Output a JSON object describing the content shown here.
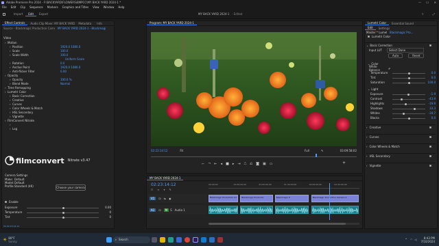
{
  "window": {
    "title": "Adobe Premiere Pro 2024 - F:\\BACKYARD\\FLOWERS\\BMPCC\\MY BACK YARD 2024-1 *",
    "menu": [
      "File",
      "Edit",
      "Clip",
      "Sequence",
      "Markers",
      "Graphics and Titles",
      "View",
      "Window",
      "Help"
    ]
  },
  "workspace": {
    "tabs": [
      "Import",
      "Edit",
      "Export"
    ],
    "active": "Edit",
    "project_title": "MY BACK YARD 2024-1",
    "project_status": "- Edited"
  },
  "effect_controls": {
    "tabs": [
      "Effect Controls",
      "Audio Clip Mixer: MY BACK YARD 2024-1",
      "Metadata",
      "Info"
    ],
    "source_label": "Source - Blackmagic Production Camera 4...",
    "sequence_label": "MY BACK YARD 2024-1 - Blackmagic P...",
    "mini_clip_label": "Blackmagic Production",
    "section_video": "Video",
    "properties": [
      {
        "name": "Motion",
        "value": "",
        "indent": 0
      },
      {
        "name": "Position",
        "value": "1920.0   1080.0",
        "indent": 1
      },
      {
        "name": "Scale",
        "value": "100.0",
        "indent": 1
      },
      {
        "name": "Scale Width",
        "value": "100.0",
        "indent": 1
      },
      {
        "name": "",
        "value": "Uniform Scale",
        "indent": 2
      },
      {
        "name": "Rotation",
        "value": "0.0",
        "indent": 1
      },
      {
        "name": "Anchor Point",
        "value": "1920.0   1080.0",
        "indent": 1
      },
      {
        "name": "Anti-flicker Filter",
        "value": "0.00",
        "indent": 1
      },
      {
        "name": "Opacity",
        "value": "",
        "indent": 0
      },
      {
        "name": "Opacity",
        "value": "100.0 %",
        "indent": 1
      },
      {
        "name": "Blend Mode",
        "value": "Normal",
        "indent": 1
      },
      {
        "name": "Time Remapping",
        "value": "",
        "indent": 0
      },
      {
        "name": "Lumetri Color",
        "value": "",
        "indent": 0
      },
      {
        "name": "Basic Correction",
        "value": "",
        "indent": 1
      },
      {
        "name": "Creative",
        "value": "",
        "indent": 1
      },
      {
        "name": "Curves",
        "value": "",
        "indent": 1
      },
      {
        "name": "Color Wheels & Match",
        "value": "",
        "indent": 1
      },
      {
        "name": "HSL Secondary",
        "value": "",
        "indent": 1
      },
      {
        "name": "Vignette",
        "value": "",
        "indent": 1
      },
      {
        "name": "FilmConvert Nitrate",
        "value": "",
        "indent": 0
      },
      {
        "name": "",
        "value": "",
        "indent": 1
      },
      {
        "name": "Log",
        "value": "",
        "indent": 1
      }
    ],
    "filmconvert": {
      "brand": "filmconvert",
      "product": "Nitrate v3.47",
      "camera_settings_label": "Camera Settings",
      "make_label": "Make:",
      "make": "Default",
      "model_label": "Model:",
      "model": "Default",
      "profile_label": "Profile:",
      "profile": "Standard (4K)",
      "choose_camera": "Choose your camera",
      "enable_label": "Enable",
      "sliders": [
        {
          "name": "Exposure",
          "value": "0.00",
          "fraction": 0.5
        },
        {
          "name": "Temperature",
          "value": "0",
          "fraction": 0.5
        },
        {
          "name": "Tint",
          "value": "0",
          "fraction": 0.5
        }
      ]
    }
  },
  "program_monitor": {
    "title": "Program: MY BACK YARD 2024-1",
    "timecode_current": "02:23:14:12",
    "fit": "Fit",
    "quality": "Full",
    "timecode_duration": "03:09:58:02"
  },
  "timeline": {
    "tab": "MY BACK YARD 2024-1",
    "timecode": "02:23:14:12",
    "ruler": [
      "00:00:00",
      "00:30:00:00",
      "01:00:00:00",
      "01:30:00:00",
      "02:00:00:00",
      "02:30:00:00"
    ],
    "tracks": [
      {
        "name": "V1",
        "type": "video"
      },
      {
        "name": "A1",
        "type": "audio",
        "label": "Audio 1"
      }
    ],
    "clips": [
      {
        "label": "Blackmagic Production Ca",
        "start": 0.0,
        "end": 0.2
      },
      {
        "label": "Blackmagic Productio",
        "start": 0.21,
        "end": 0.43
      },
      {
        "label": "Blackmagic P",
        "start": 0.44,
        "end": 0.67
      },
      {
        "label": "Blackmagic Production Camera 4",
        "start": 0.68,
        "end": 1.0
      }
    ],
    "playhead_fraction": 0.8
  },
  "lumetri": {
    "tabs": [
      "Lumetri Color",
      "Essential Sound"
    ],
    "sub_tabs": [
      "Edit",
      "Settings"
    ],
    "master_label": "Master * Lumetri Color",
    "source_label": "Blackmagic Pro...",
    "effect_label": "Lumetri Color",
    "basic_correction": "Basic Correction",
    "input_lut_label": "Input LUT",
    "input_lut_value": "Select Done",
    "auto_label": "Auto",
    "reset_label": "Reset",
    "color_label": "Color",
    "white_balance_label": "White Balance",
    "color_sliders": [
      {
        "name": "Temperature",
        "value": "0.0",
        "fraction": 0.5
      },
      {
        "name": "Tint",
        "value": "0.0",
        "fraction": 0.5
      },
      {
        "name": "Saturation",
        "value": "100.0",
        "fraction": 0.5
      }
    ],
    "light_label": "Light",
    "light_sliders": [
      {
        "name": "Exposure",
        "value": "-1.9",
        "fraction": 0.47
      },
      {
        "name": "Contrast",
        "value": "-43.9",
        "fraction": 0.28
      },
      {
        "name": "Highlights",
        "value": "-19.9",
        "fraction": 0.4
      },
      {
        "name": "Shadows",
        "value": "33.3",
        "fraction": 0.66
      },
      {
        "name": "Whites",
        "value": "-34.7",
        "fraction": 0.33
      },
      {
        "name": "Blacks",
        "value": "0.0",
        "fraction": 0.5
      }
    ],
    "sections": [
      "Creative",
      "Curves",
      "Color Wheels & Match",
      "HSL Secondary",
      "Vignette"
    ]
  },
  "taskbar": {
    "temperature": "80°F",
    "weather": "Sunny",
    "search_placeholder": "Search",
    "time": "8:43 PM",
    "date": "7/10/2024"
  }
}
